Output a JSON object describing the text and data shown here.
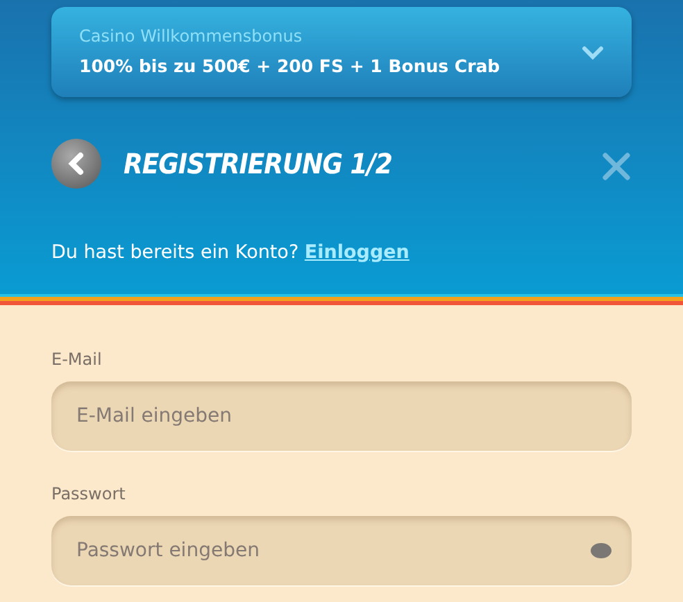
{
  "bonus": {
    "label": "Casino Willkommensbonus",
    "text": "100% bis zu 500€ + 200 FS + 1 Bonus Crab",
    "expanded": false
  },
  "header": {
    "title": "REGISTRIERUNG 1/2"
  },
  "login_prompt": {
    "text": "Du hast bereits ein Konto?",
    "link": "Einloggen"
  },
  "fields": [
    {
      "kind": "email",
      "label": "E-Mail",
      "placeholder": "E-Mail eingeben"
    },
    {
      "kind": "password",
      "label": "Passwort",
      "placeholder": "Passwort eingeben"
    }
  ]
}
